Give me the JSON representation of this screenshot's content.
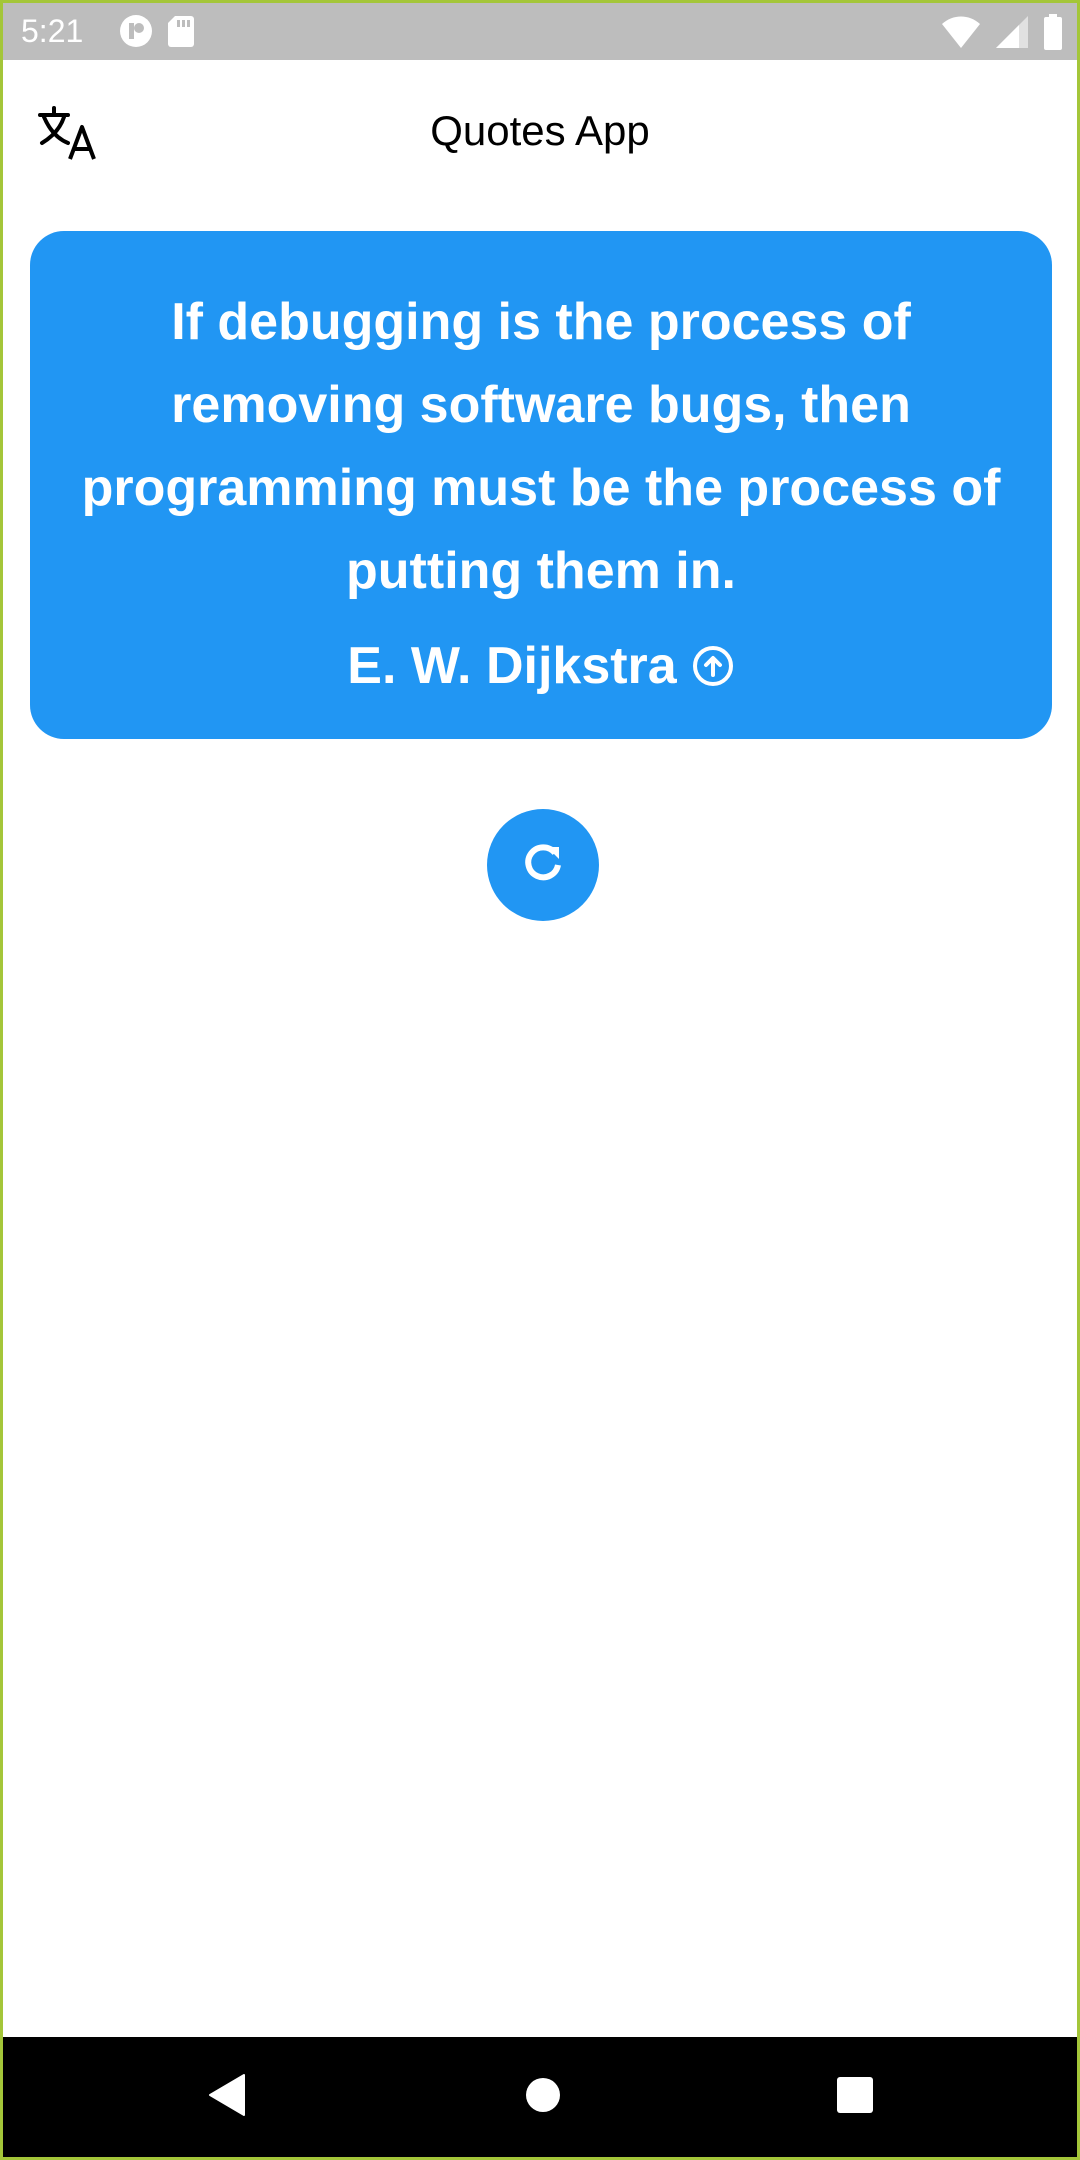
{
  "status_bar": {
    "time": "5:21",
    "left_icons": [
      "pinwheel-icon",
      "sd-card-icon"
    ],
    "right_icons": [
      "wifi-icon",
      "cell-signal-icon",
      "battery-icon"
    ]
  },
  "app_bar": {
    "title": "Quotes App",
    "translate_icon": "translate-icon"
  },
  "quote": {
    "text": "If debugging is the process of removing software bugs, then programming must be the process of putting them in.",
    "author": "E. W. Dijkstra",
    "author_link_icon": "arrow-up-circle-icon"
  },
  "actions": {
    "refresh_icon": "refresh-icon"
  },
  "nav_bar": {
    "buttons": [
      "back-icon",
      "home-icon",
      "recents-icon"
    ]
  },
  "colors": {
    "accent": "#2196f3",
    "status_bar": "#bdbdbd",
    "nav_bar": "#000000",
    "card_text": "#ffffff"
  }
}
